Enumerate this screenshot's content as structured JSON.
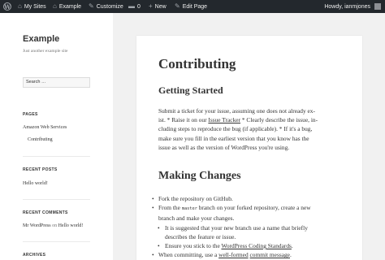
{
  "adminbar": {
    "my_sites": "My Sites",
    "site_name": "Example",
    "customize": "Customize",
    "comments_count": "0",
    "new": "New",
    "edit_page": "Edit Page",
    "howdy": "Howdy, ianmjones"
  },
  "sidebar": {
    "title": "Example",
    "description": "Just another example site",
    "search_placeholder": "Search …",
    "pages_title": "PAGES",
    "pages": [
      "Amazon Web Services",
      "Contributing"
    ],
    "recent_posts_title": "RECENT POSTS",
    "recent_posts": [
      "Hello world!"
    ],
    "recent_comments_title": "RECENT COMMENTS",
    "recent_comment": {
      "author": "Mr WordPress",
      "on": "on",
      "post": "Hello world!"
    },
    "archives_title": "ARCHIVES"
  },
  "article": {
    "title": "Contributing",
    "h_getting_started": "Getting Started",
    "para": [
      "Submit a ticket for your issue, assuming one does not already ex-",
      "ist. * Raise it on our ",
      "Issue Tracker",
      " * Clearly describe the issue, in-",
      "cluding steps to reproduce the bug (if applicable). * If it's a bug,",
      "make sure you fill in the earliest version that you know has the",
      "issue as well as the version of WordPress you're using."
    ],
    "h_making_changes": "Making Changes",
    "bullets": {
      "b1": "Fork the repository on GitHub.",
      "b2_pre": "From the ",
      "b2_code": "master",
      "b2_post": " branch on your forked repository, create a new",
      "b2_line2": "branch and make your changes.",
      "b3_line1": "It is suggested that your new branch use a name that briefly",
      "b3_line2": "describes the feature or issue.",
      "b4_pre": "Ensure you stick to the ",
      "b4_link": "WordPress Coding Standards",
      "b4_post": ".",
      "b5_pre": "When committing, use a ",
      "b5_link1": "well-formed",
      "b5_mid": " ",
      "b5_link2": "commit message",
      "b5_post": "."
    }
  }
}
